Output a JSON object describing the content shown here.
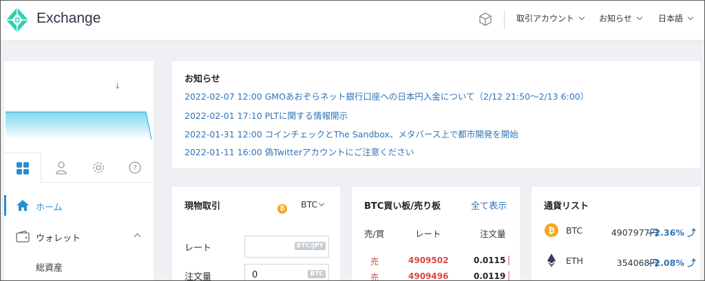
{
  "header": {
    "title": "Exchange",
    "menus": [
      {
        "label": "取引アカウント"
      },
      {
        "label": "お知らせ"
      },
      {
        "label": "日本語"
      }
    ],
    "icons": {
      "logo": "exchange-logo",
      "cube": "cube-icon"
    }
  },
  "sidebar": {
    "tabs": [
      {
        "icon": "grid-icon"
      },
      {
        "icon": "user-icon"
      },
      {
        "icon": "gear-icon"
      },
      {
        "icon": "help-icon"
      }
    ],
    "nav": {
      "home": "ホーム",
      "wallet": "ウォレット",
      "total_assets": "総資産"
    },
    "indicator": "↓"
  },
  "news": {
    "title": "お知らせ",
    "items": [
      {
        "date": "2022-02-07 12:00",
        "text": "GMOあおぞらネット銀行口座への日本円入金について（2/12 21:50〜2/13 6:00）"
      },
      {
        "date": "2022-02-01 17:10",
        "text": "PLTに関する情報開示"
      },
      {
        "date": "2022-01-31 12:00",
        "text": "コインチェックとThe Sandbox、メタバース上で都市開発を開始"
      },
      {
        "date": "2022-01-11 16:00",
        "text": "偽Twitterアカウントにご注意ください"
      }
    ]
  },
  "spot": {
    "title": "現物取引",
    "coin": "BTC",
    "coin_symbol": "₿",
    "rate_label": "レート",
    "rate_unit": "BTC/JPY",
    "rate_value": "",
    "qty_label": "注文量",
    "qty_value": "0",
    "qty_unit": "BTC"
  },
  "orderbook": {
    "title": "BTC買い板/売り板",
    "show_all": "全て表示",
    "headers": {
      "side": "売/買",
      "rate": "レート",
      "qty": "注文量"
    },
    "rows": [
      {
        "side": "売",
        "rate": "4909502",
        "qty": "0.0115"
      },
      {
        "side": "売",
        "rate": "4909496",
        "qty": "0.0119"
      }
    ]
  },
  "currencies": {
    "title": "通貨リスト",
    "items": [
      {
        "name": "BTC",
        "price": "4907977円",
        "change": "+2.36%",
        "icon": "bitcoin-icon"
      },
      {
        "name": "ETH",
        "price": "354068円",
        "change": "+2.08%",
        "icon": "ethereum-icon"
      }
    ],
    "trend_symbol": "⤴"
  },
  "colors": {
    "accent": "#2a8dd4",
    "logo": "#2fcfb0",
    "sell": "#e04444",
    "link": "#2f73b8"
  }
}
